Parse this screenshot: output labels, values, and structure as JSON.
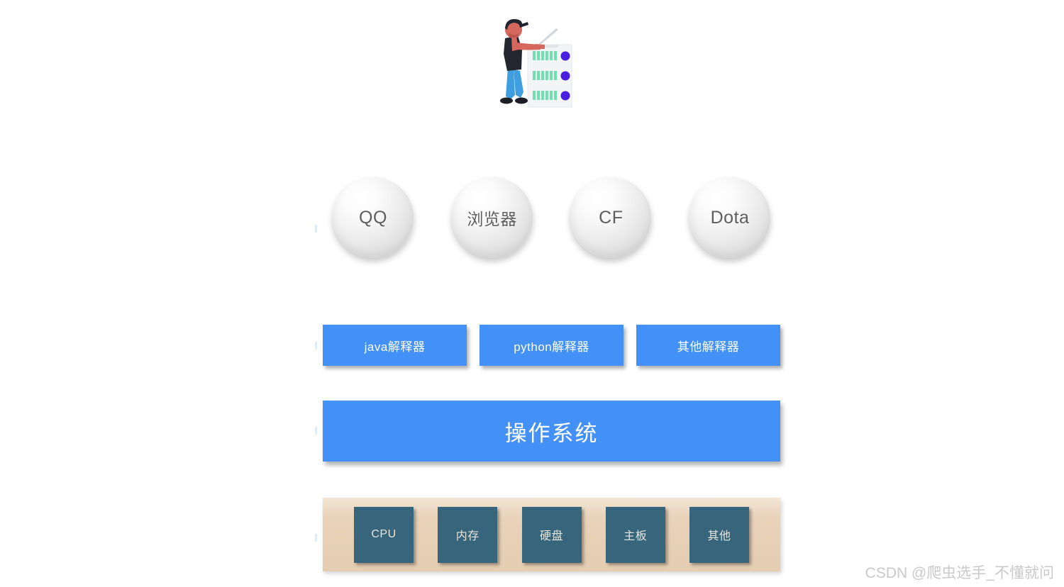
{
  "page": {
    "background": "#ffffff",
    "accent_blue": "#4390f7",
    "hardware_panel_color": "#e5cdb2",
    "hardware_box_color": "#37667c",
    "sphere_text_color": "#5d5d5d"
  },
  "illustration": {
    "name": "person-with-laptop-at-server-rack",
    "parts": {
      "person_skin": "#d4675e",
      "person_hair": "#1f2430",
      "person_vest": "#23262e",
      "person_jeans": "#3f9ee0",
      "server_body": "#eceef0",
      "server_leds": "#6fe0b0",
      "server_buttons": "#4b1fe0",
      "laptop": "#cfd6dc"
    }
  },
  "applications": {
    "label": "applications-layer",
    "items": [
      {
        "label": "QQ",
        "script": "latin"
      },
      {
        "label": "浏览器",
        "script": "cjk"
      },
      {
        "label": "CF",
        "script": "latin"
      },
      {
        "label": "Dota",
        "script": "latin"
      }
    ]
  },
  "interpreters": {
    "label": "interpreters-layer",
    "items": [
      {
        "label": "java解释器"
      },
      {
        "label": "python解释器"
      },
      {
        "label": "其他解释器"
      }
    ]
  },
  "operating_system": {
    "label": "操作系统"
  },
  "hardware": {
    "label": "hardware-layer",
    "items": [
      {
        "label": "CPU"
      },
      {
        "label": "内存"
      },
      {
        "label": "硬盘"
      },
      {
        "label": "主板"
      },
      {
        "label": "其他"
      }
    ]
  },
  "watermark": {
    "text": "CSDN @爬虫选手_不懂就问"
  }
}
